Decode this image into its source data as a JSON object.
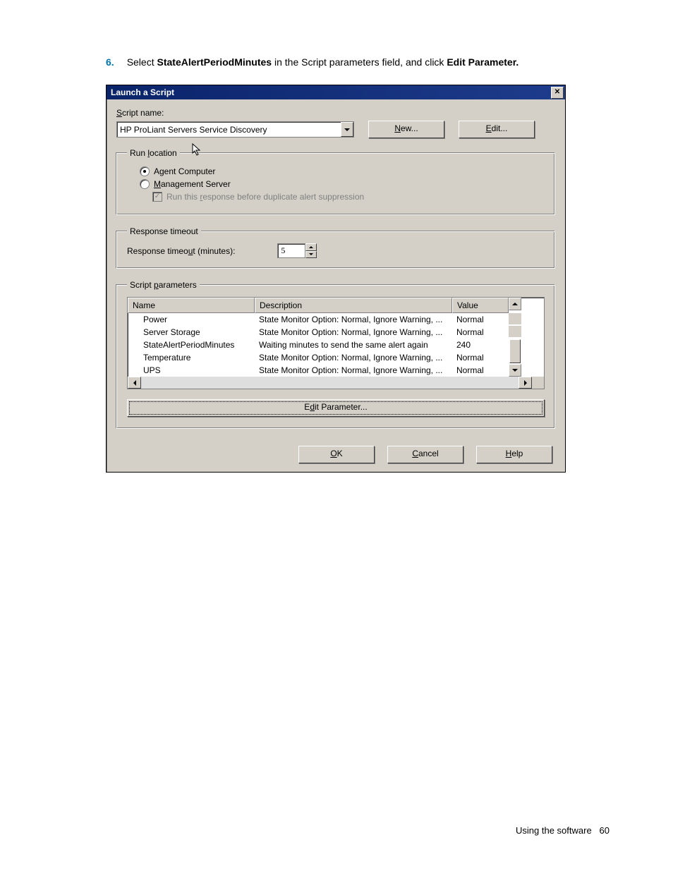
{
  "instruction": {
    "number": "6.",
    "t1": "Select ",
    "b1": "StateAlertPeriodMinutes",
    "t2": " in the Script parameters field, and click ",
    "b2": "Edit Parameter."
  },
  "dialog": {
    "title": "Launch a Script",
    "scriptname_label_pre": "S",
    "scriptname_label_post": "cript name:",
    "scriptname_value": "HP ProLiant Servers Service Discovery",
    "new_btn_u": "N",
    "new_btn_rest": "ew...",
    "edit_btn_u": "E",
    "edit_btn_rest": "dit...",
    "runloc": {
      "legend_pre": "Run ",
      "legend_u": "l",
      "legend_post": "ocation",
      "agent": "Agent Computer",
      "mgmt_u": "M",
      "mgmt_rest": "anagement Server",
      "runresp_pre": "Run this ",
      "runresp_u": "r",
      "runresp_post": "esponse before duplicate alert suppression"
    },
    "timeout": {
      "legend": "Response timeout",
      "label_pre": "Response timeo",
      "label_u": "u",
      "label_post": "t (minutes):",
      "value": "5"
    },
    "params": {
      "legend_pre": "Script ",
      "legend_u": "p",
      "legend_post": "arameters",
      "headers": {
        "name": "Name",
        "desc": "Description",
        "value": "Value"
      },
      "rows": [
        {
          "name": "Power",
          "desc": "State Monitor Option: Normal, Ignore Warning, ...",
          "value": "Normal"
        },
        {
          "name": "Server Storage",
          "desc": "State Monitor Option: Normal, Ignore Warning, ...",
          "value": "Normal"
        },
        {
          "name": "StateAlertPeriodMinutes",
          "desc": "Waiting minutes to send the same alert again",
          "value": "240"
        },
        {
          "name": "Temperature",
          "desc": "State Monitor Option: Normal, Ignore Warning, ...",
          "value": "Normal"
        },
        {
          "name": "UPS",
          "desc": "State Monitor Option: Normal, Ignore Warning, ...",
          "value": "Normal"
        }
      ],
      "edit_btn_pre": "E",
      "edit_btn_u": "d",
      "edit_btn_post": "it Parameter..."
    },
    "actions": {
      "ok_u": "O",
      "ok_rest": "K",
      "cancel_u": "C",
      "cancel_rest": "ancel",
      "help_u": "H",
      "help_rest": "elp"
    }
  },
  "footer": {
    "text": "Using the software",
    "page": "60"
  }
}
